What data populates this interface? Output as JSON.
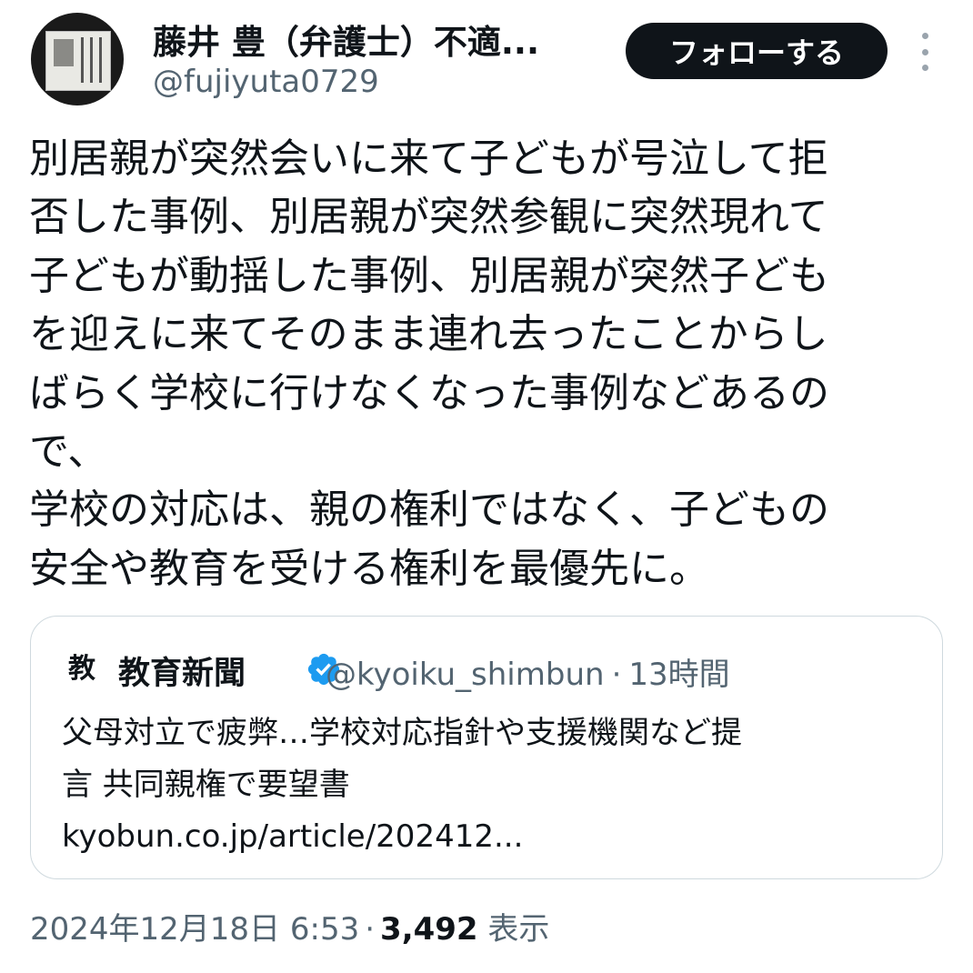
{
  "author": {
    "display_name": "藤井 豊（弁護士）不適...",
    "handle": "@fujiyuta0729",
    "follow_label": "フォローする"
  },
  "tweet": {
    "text": "別居親が突然会いに来て子どもが号泣して拒\n否した事例、別居親が突然参観に突然現れて\n子どもが動揺した事例、別居親が突然子ども\nを迎えに来てそのまま連れ去ったことからし\nばらく学校に行けなくなった事例などあるの\nで、\n学校の対応は、親の権利ではなく、子どもの\n安全や教育を受ける権利を最優先に。"
  },
  "quote": {
    "logo_text": "教",
    "name": "教育新聞",
    "handle": "@kyoiku_shimbun",
    "separator": "·",
    "time": "13時間",
    "text": "父母対立で疲弊…学校対応指針や支援機関など提\n言 共同親権で要望書\nkyobun.co.jp/article/202412..."
  },
  "footer": {
    "timestamp": "2024年12月18日 6:53",
    "separator": "·",
    "views_count": "3,492",
    "views_label": "表示"
  },
  "colors": {
    "text": "#0f1419",
    "secondary": "#536471",
    "border": "#cfd9de",
    "verified": "#1d9bf0"
  },
  "icons": {
    "more": "more-icon",
    "verified": "verified-badge-icon"
  }
}
